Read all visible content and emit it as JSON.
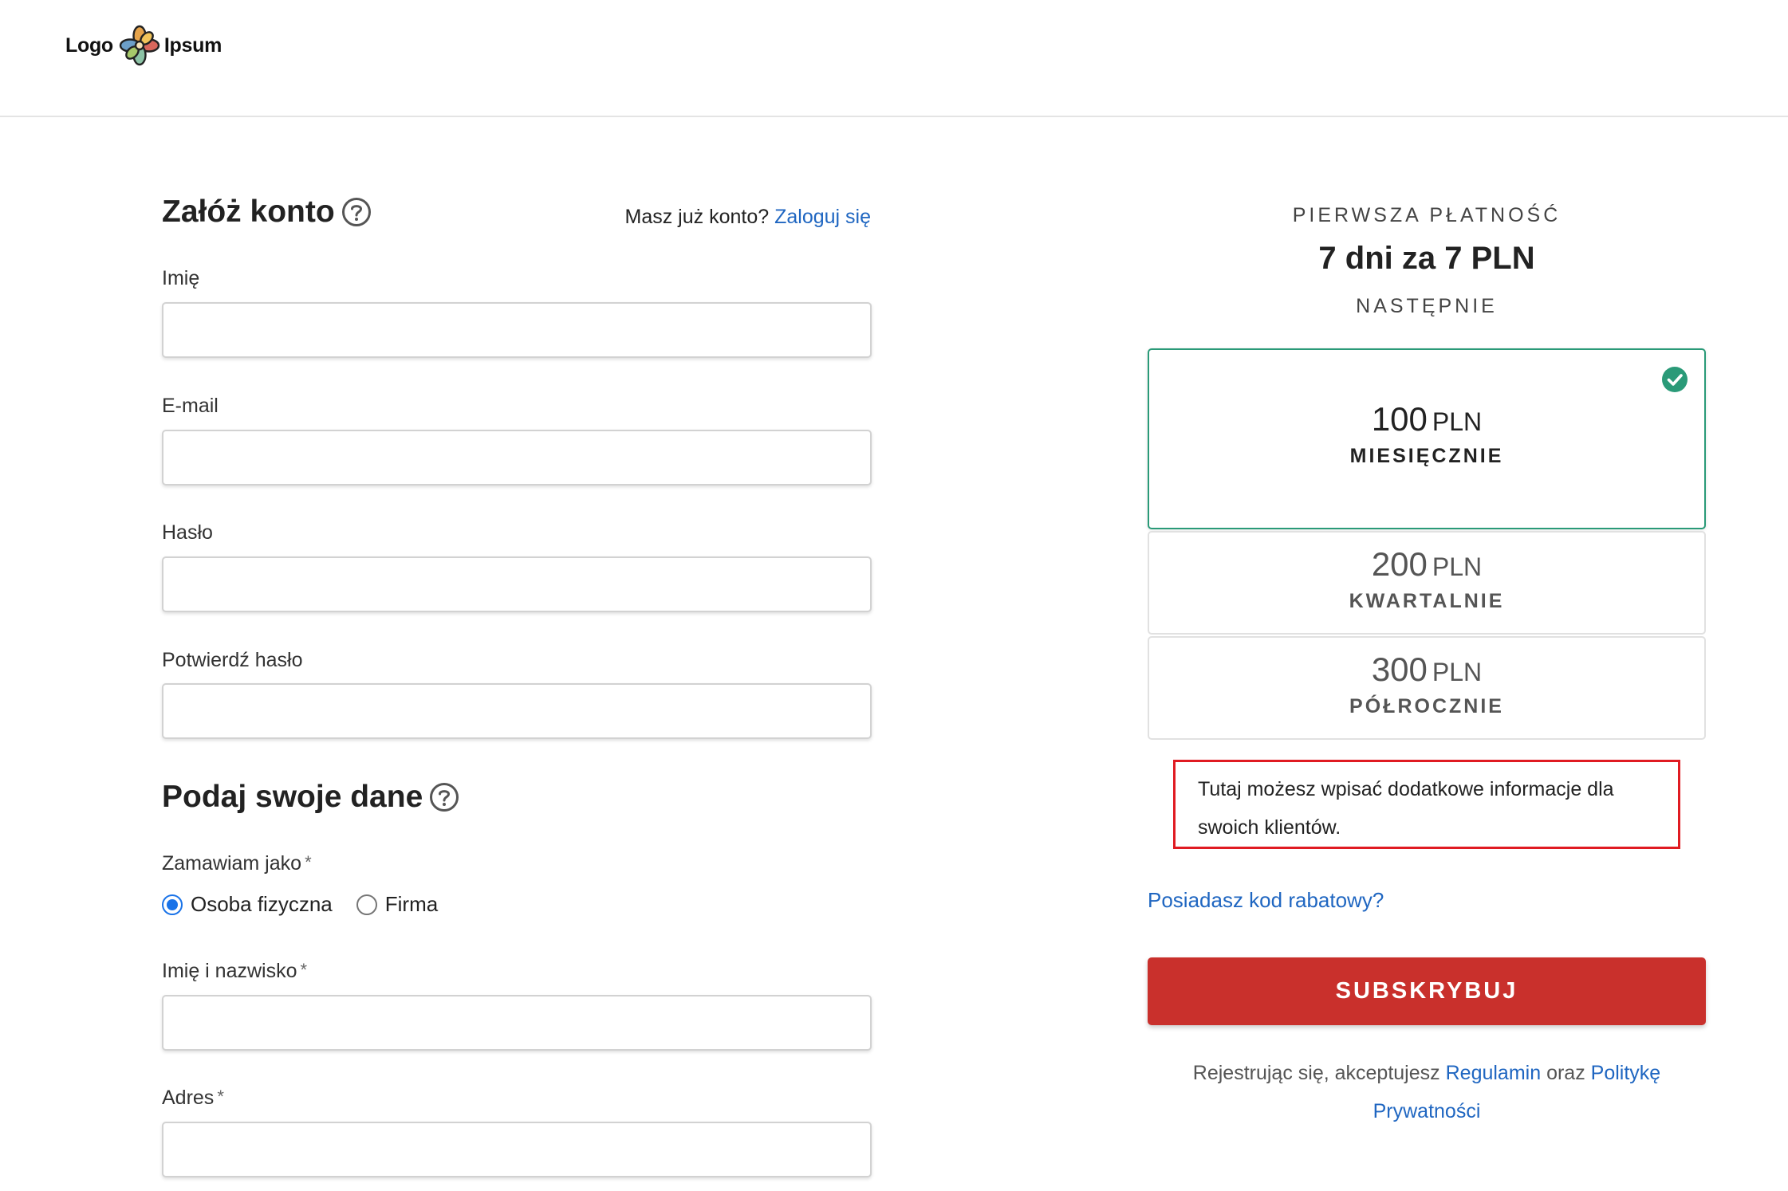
{
  "header": {
    "logo_left": "Logo",
    "logo_right": "Ipsum",
    "logo_icon": "flower-logo-icon"
  },
  "account": {
    "title": "Załóż konto",
    "help_icon": "question-circle-icon",
    "login_prompt": "Masz już konto?",
    "login_link": "Zaloguj się",
    "fields": {
      "first_name": "Imię",
      "email": "E-mail",
      "password": "Hasło",
      "confirm_password": "Potwierdź hasło"
    }
  },
  "details": {
    "title": "Podaj swoje dane",
    "help_icon": "question-circle-icon",
    "order_as_label": "Zamawiam jako",
    "required_mark": "*",
    "order_as_options": [
      {
        "label": "Osoba fizyczna",
        "selected": true
      },
      {
        "label": "Firma",
        "selected": false
      }
    ],
    "full_name_label": "Imię i nazwisko",
    "address_label": "Adres"
  },
  "pricing": {
    "first_payment_label": "PIERWSZA PŁATNOŚĆ",
    "first_payment_value": "7 dni za 7 PLN",
    "next_label": "NASTĘPNIE",
    "plans": [
      {
        "amount": "100",
        "currency": "PLN",
        "period": "MIESIĘCZNIE",
        "selected": true
      },
      {
        "amount": "200",
        "currency": "PLN",
        "period": "KWARTALNIE",
        "selected": false
      },
      {
        "amount": "300",
        "currency": "PLN",
        "period": "PÓŁROCZNIE",
        "selected": false
      }
    ],
    "info_text": "Tutaj możesz wpisać dodatkowe informacje dla swoich klientów.",
    "discount_link": "Posiadasz kod rabatowy?",
    "subscribe_button": "SUBSKRYBUJ",
    "terms_prefix": "Rejestrując się, akceptujesz",
    "terms_link": "Regulamin",
    "terms_mid": "oraz",
    "privacy_link": "Politykę Prywatności"
  },
  "colors": {
    "link": "#1f66c1",
    "accent_selected": "#2a9a78",
    "subscribe": "#c9302c",
    "info_border": "#e01b22"
  }
}
